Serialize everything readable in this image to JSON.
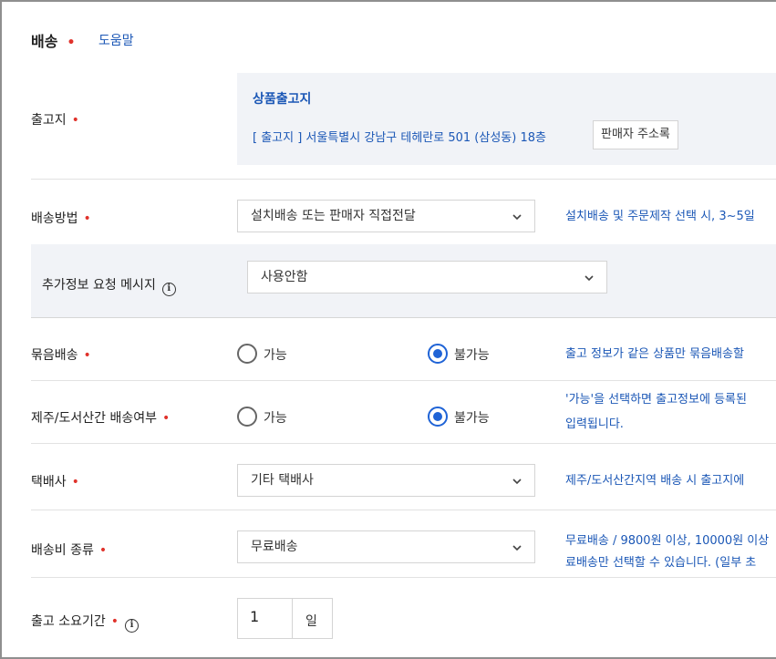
{
  "section": {
    "title": "배송",
    "help_link": "도움말"
  },
  "origin": {
    "label": "출고지",
    "box_title": "상품출고지",
    "address": "[ 출고지 ] 서울특별시 강남구 테헤란로 501 (삼성동) 18층",
    "address_button": "판매자 주소록"
  },
  "shipping_method": {
    "label": "배송방법",
    "selected": "설치배송 또는 판매자 직접전달",
    "hint": "설치배송 및 주문제작 선택 시, 3~5일"
  },
  "extra_info": {
    "label": "추가정보 요청 메시지",
    "selected": "사용안함"
  },
  "bundle": {
    "label": "묶음배송",
    "option_yes": "가능",
    "option_no": "불가능",
    "selected": "불가능",
    "hint": "출고 정보가 같은 상품만 묶음배송할"
  },
  "jeju": {
    "label": "제주/도서산간 배송여부",
    "option_yes": "가능",
    "option_no": "불가능",
    "selected": "불가능",
    "hint_line1": "'가능'을 선택하면 출고정보에 등록된",
    "hint_line2": "입력됩니다."
  },
  "courier": {
    "label": "택배사",
    "selected": "기타 택배사",
    "hint": "제주/도서산간지역 배송 시 출고지에"
  },
  "fee_type": {
    "label": "배송비 종류",
    "selected": "무료배송",
    "hint_line1": "무료배송 / 9800원 이상, 10000원 이상",
    "hint_line2": "료배송만 선택할 수 있습니다. (일부 초"
  },
  "lead_time": {
    "label": "출고 소요기간",
    "value": "1",
    "unit": "일"
  },
  "colors": {
    "accent": "#1f63d6",
    "link": "#1b57b6",
    "required": "#e0322b"
  },
  "icons": {
    "dropdown": "chevron-down-icon",
    "info": "info-icon"
  }
}
